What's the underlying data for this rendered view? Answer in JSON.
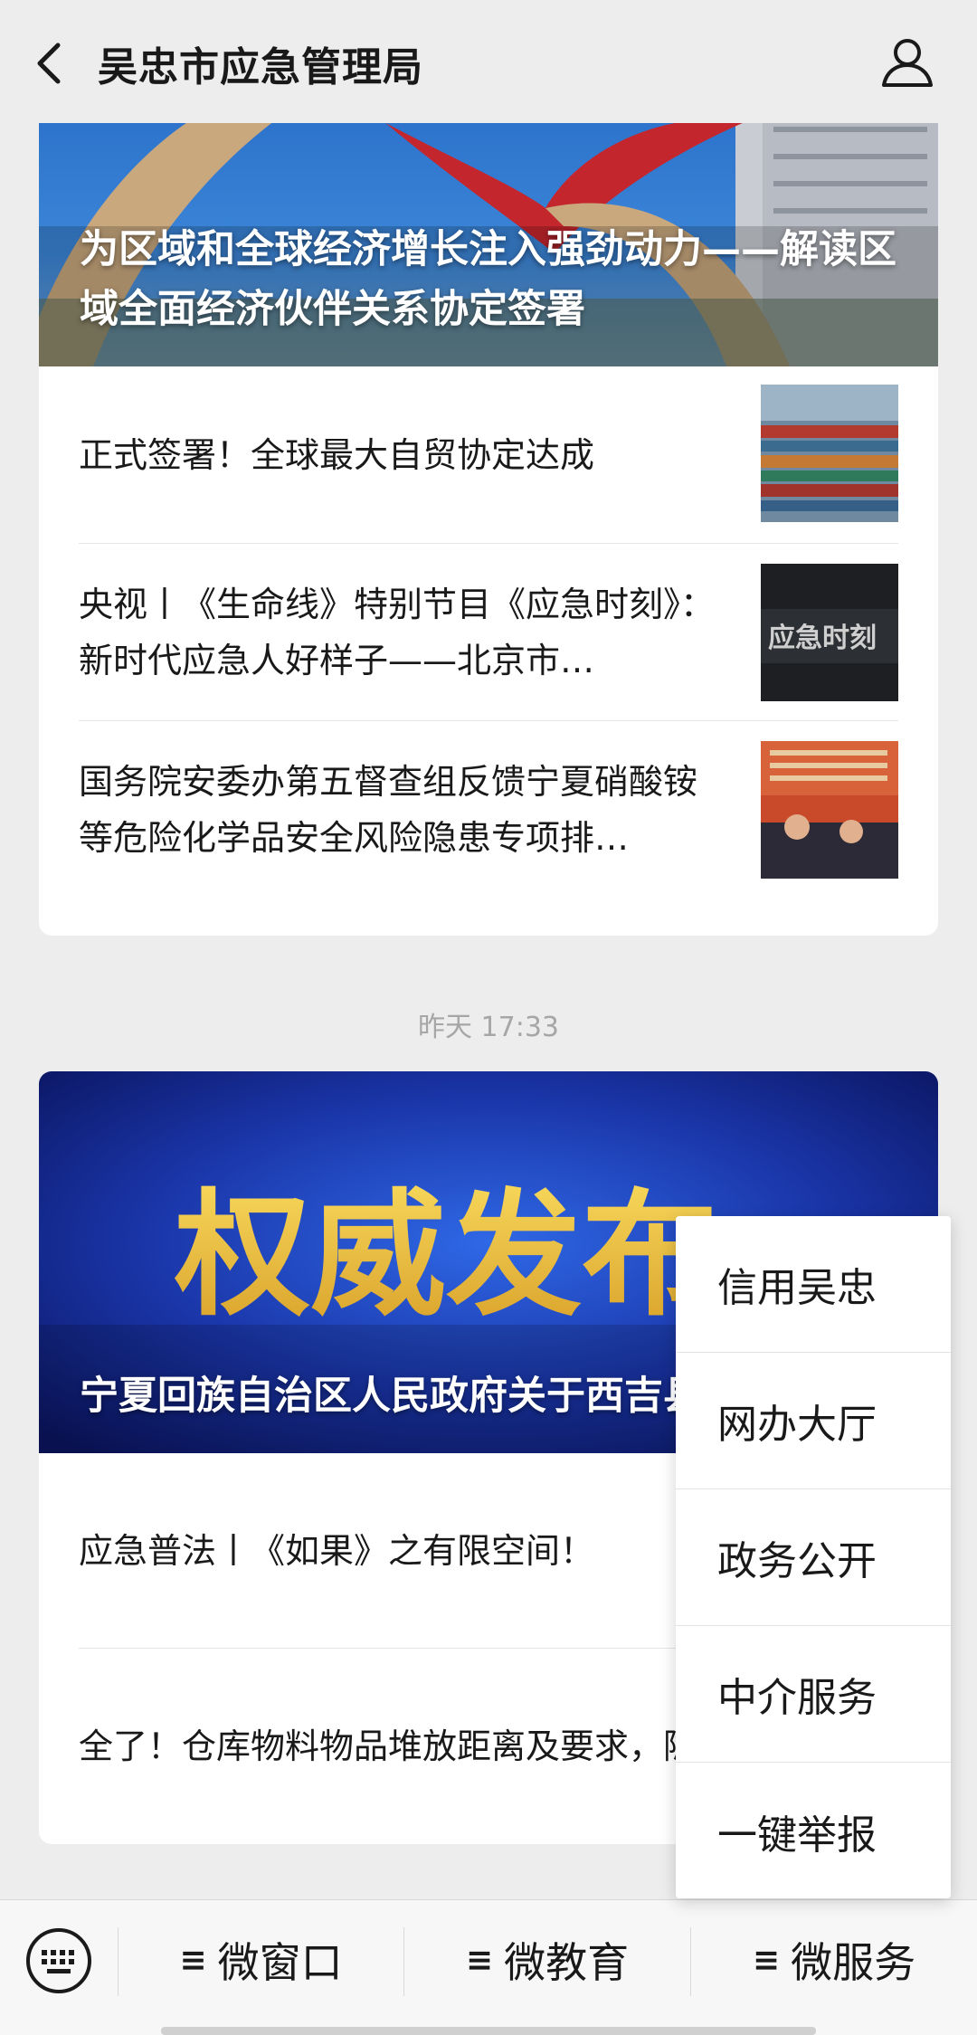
{
  "header": {
    "title": "吴忠市应急管理局"
  },
  "group1": {
    "cover_title": "为区域和全球经济增长注入强劲动力——解读区域全面经济伙伴关系协定签署",
    "items": [
      {
        "title": "正式签署！全球最大自贸协定达成"
      },
      {
        "title": "央视丨《生命线》特别节目《应急时刻》：新时代应急人好样子——北京市…",
        "thumb_text": "应急时刻"
      },
      {
        "title": "国务院安委办第五督查组反馈宁夏硝酸铵等危险化学品安全风险隐患专项排…"
      }
    ]
  },
  "timestamp": "昨天 17:33",
  "group2": {
    "cover_banner": "权威发布",
    "cover_title": "宁夏回族自治区人民政府关于西吉县序列的公告",
    "items": [
      {
        "title": "应急普法丨《如果》之有限空间！"
      },
      {
        "title": "全了！仓库物料物品堆放距离及要求，隐患对应依据"
      }
    ]
  },
  "popup_menu": {
    "items": [
      "信用吴忠",
      "网办大厅",
      "政务公开",
      "中介服务",
      "一键举报"
    ]
  },
  "bottom_menu": {
    "items": [
      {
        "label": "微窗口"
      },
      {
        "label": "微教育"
      },
      {
        "label": "微服务"
      }
    ]
  },
  "colors": {
    "background": "#ededed",
    "card": "#ffffff",
    "timestamp": "#a6a6a6"
  }
}
